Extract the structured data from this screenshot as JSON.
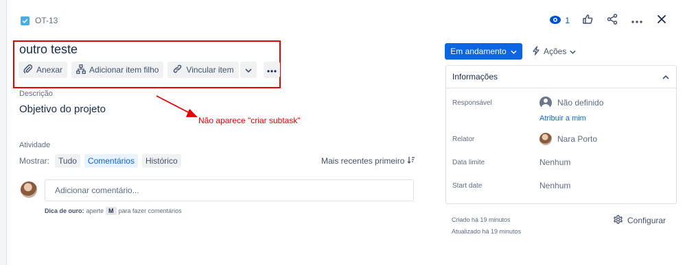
{
  "issue": {
    "key": "OT-13",
    "title": "outro teste"
  },
  "header": {
    "watch_count": "1"
  },
  "toolbar": {
    "attach_label": "Anexar",
    "add_child_label": "Adicionar item filho",
    "link_item_label": "Vincular item"
  },
  "description": {
    "label": "Descrição",
    "text": "Objetivo do projeto"
  },
  "annotation": {
    "text": "Não aparece \"criar subtask\"",
    "color": "#e80000"
  },
  "activity": {
    "label": "Atividade",
    "show_label": "Mostrar:",
    "filters": [
      "Tudo",
      "Comentários",
      "Histórico"
    ],
    "active_filter": "Comentários",
    "sort_label": "Mais recentes primeiro"
  },
  "comment": {
    "placeholder": "Adicionar comentário...",
    "tip_bold": "Dica de ouro:",
    "tip_press": "aperte",
    "tip_key": "M",
    "tip_rest": "para fazer comentários"
  },
  "sidebar": {
    "status_label": "Em andamento",
    "actions_label": "Ações",
    "details_title": "Informações",
    "fields": {
      "assignee_label": "Responsável",
      "assignee_value": "Não definido",
      "assign_to_me": "Atribuir a mim",
      "reporter_label": "Relator",
      "reporter_value": "Nara Porto",
      "due_date_label": "Data limite",
      "due_date_value": "Nenhum",
      "start_date_label": "Start date",
      "start_date_value": "Nenhum"
    },
    "created": "Criado há 19 minutos",
    "updated": "Atualizado há 19 minutos",
    "configure_label": "Configurar"
  },
  "colors": {
    "primary": "#0c66e4",
    "annotation": "#e80000",
    "issue_type": "#4bade8"
  }
}
